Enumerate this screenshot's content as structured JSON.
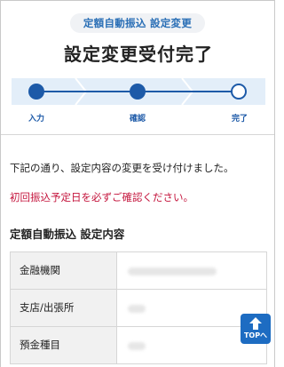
{
  "header": {
    "badge": "定額自動振込 設定変更",
    "title": "設定変更受付完了"
  },
  "stepper": {
    "steps": [
      {
        "label": "入力",
        "state": "done"
      },
      {
        "label": "確認",
        "state": "done"
      },
      {
        "label": "完了",
        "state": "current"
      }
    ]
  },
  "body": {
    "message": "下記の通り、設定内容の変更を受け付けました。",
    "notice": "初回振込予定日を必ずご確認ください。",
    "section_title": "定額自動振込 設定内容"
  },
  "table": {
    "rows": [
      {
        "label": "金融機関"
      },
      {
        "label": "支店/出張所"
      },
      {
        "label": "預金種目"
      }
    ]
  },
  "top_button": {
    "label": "TOPへ"
  },
  "colors": {
    "accent": "#1d5aa8",
    "notice": "#c4143c",
    "stepper_band": "#e3eef9",
    "top_button": "#1d6cc2"
  }
}
